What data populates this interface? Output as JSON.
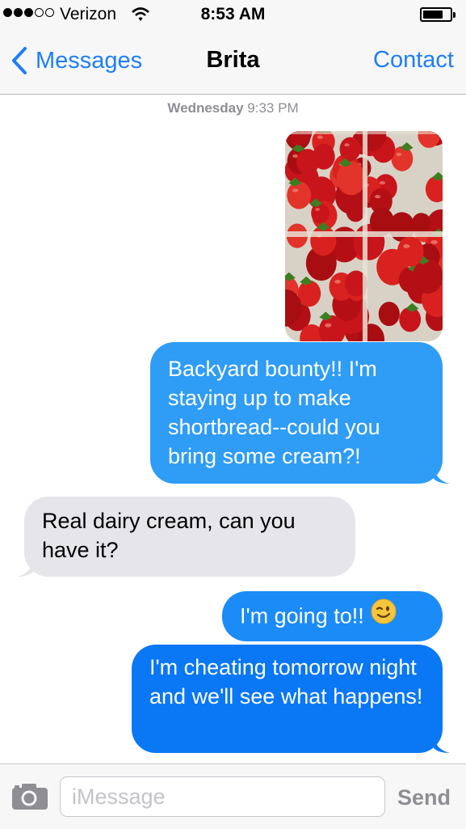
{
  "status_bar": {
    "carrier": "Verizon",
    "time": "8:53 AM",
    "signal_bars_filled": 3,
    "signal_bars_total": 5
  },
  "nav": {
    "back_label": "Messages",
    "title": "Brita",
    "contact_label": "Contact"
  },
  "thread": {
    "day": "Wednesday",
    "time": "9:33 PM",
    "messages": [
      {
        "from": "me",
        "kind": "image",
        "alt": "strawberries"
      },
      {
        "from": "me",
        "kind": "text",
        "text": "Backyard bounty!! I'm staying up to make shortbread--could you bring some cream?!"
      },
      {
        "from": "them",
        "kind": "text",
        "text": "Real dairy cream, can you have it?"
      },
      {
        "from": "me",
        "kind": "text",
        "text": "I'm going to!!",
        "emoji": "winking-face"
      },
      {
        "from": "me",
        "kind": "text",
        "text": "I'm cheating tomorrow night and we'll see what happens!"
      }
    ]
  },
  "input_bar": {
    "placeholder": "iMessage",
    "value": "",
    "send_label": "Send"
  },
  "colors": {
    "accent": "#1f7ef5",
    "sent_bubble_top": "#2f9cf6",
    "sent_bubble_bottom": "#0a77f5",
    "received_bubble": "#e5e5ea",
    "timestamp": "#8e8e93"
  }
}
